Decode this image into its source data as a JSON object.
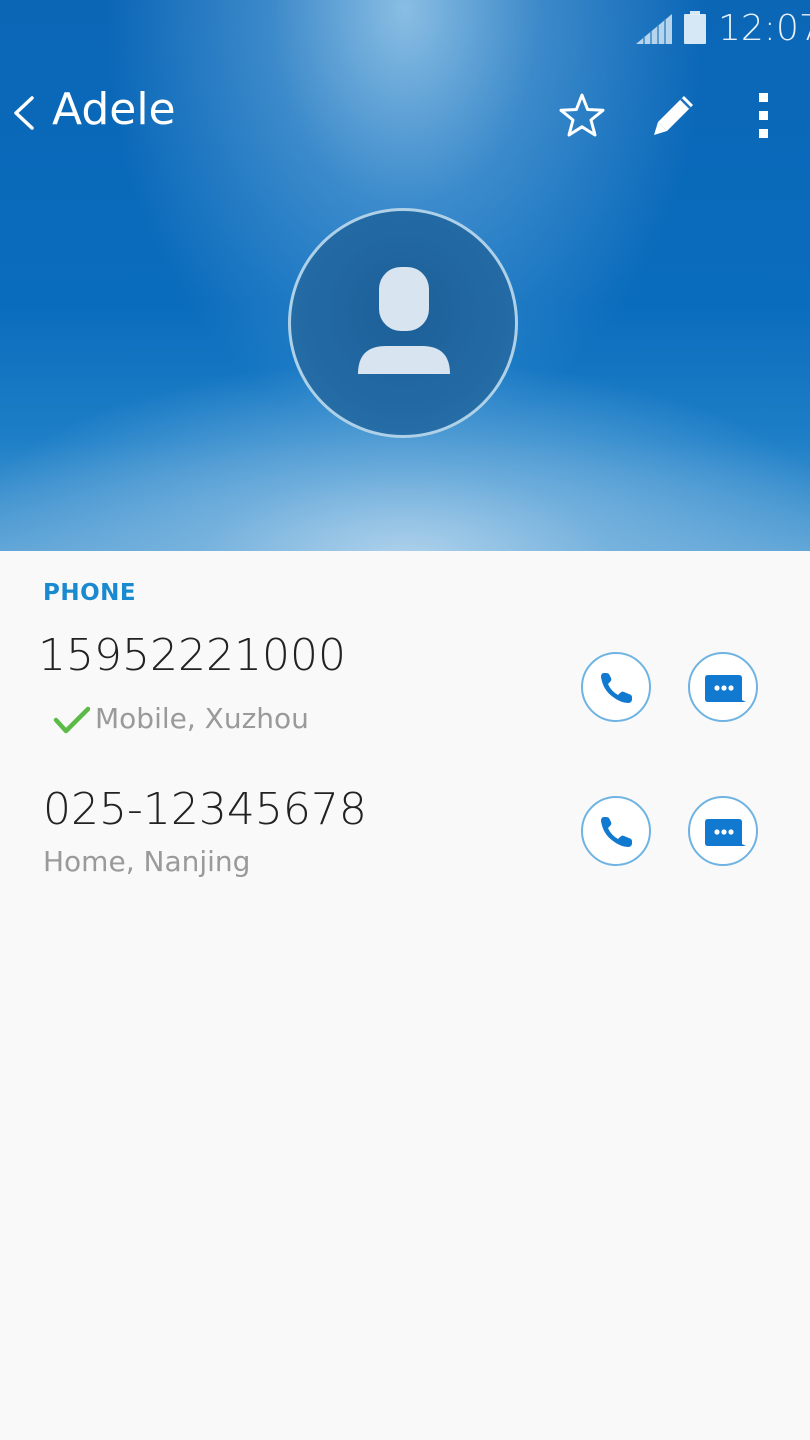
{
  "status_bar": {
    "time": "12:07",
    "icons": [
      "signal-icon",
      "battery-icon"
    ]
  },
  "toolbar": {
    "title": "Adele",
    "icons": [
      "back-icon",
      "star-icon",
      "edit-icon",
      "more-icon"
    ]
  },
  "avatar": {
    "icon": "person-icon"
  },
  "phone_section": {
    "label": "PHONE",
    "entries": [
      {
        "number": "15952221000",
        "type": "Mobile,",
        "location": "Xuzhou",
        "verified_icon": "check-icon"
      },
      {
        "number": "025-12345678",
        "type": "Home,",
        "location": "Nanjing"
      }
    ]
  },
  "colors": {
    "accent": "#1a8ad0",
    "header_blue": "#0a6cbd",
    "check_green": "#5cba47",
    "button_border": "#6fb3e3"
  }
}
